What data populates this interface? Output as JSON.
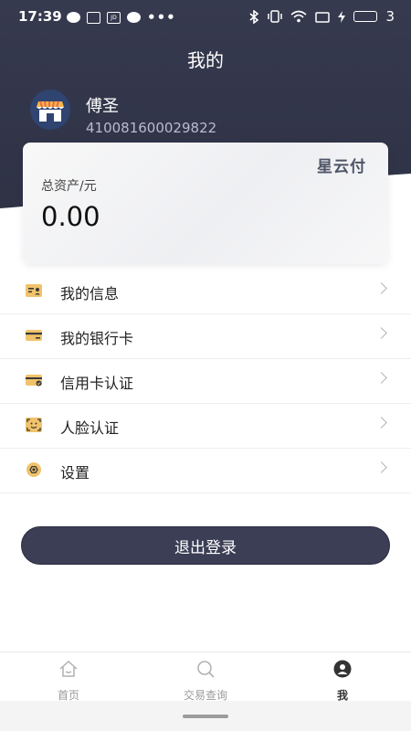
{
  "status_bar": {
    "time": "17:39",
    "notif_app_label": "JD",
    "battery_level": "3",
    "icons": [
      "chat-icon",
      "news-icon",
      "jd-icon",
      "chat-icon",
      "more-icon",
      "bluetooth-icon",
      "vibrate-icon",
      "wifi-icon",
      "battery-icon"
    ]
  },
  "header": {
    "title": "我的",
    "user_name": "傅圣",
    "user_id": "410081600029822"
  },
  "asset_card": {
    "brand": "星云付",
    "label": "总资产/元",
    "value": "0.00"
  },
  "menu": [
    {
      "label": "我的信息",
      "icon": "id-card-icon"
    },
    {
      "label": "我的银行卡",
      "icon": "bank-card-icon"
    },
    {
      "label": "信用卡认证",
      "icon": "credit-card-verify-icon"
    },
    {
      "label": "人脸认证",
      "icon": "face-scan-icon"
    },
    {
      "label": "设置",
      "icon": "settings-icon"
    }
  ],
  "logout_label": "退出登录",
  "bottom_nav": [
    {
      "label": "首页",
      "icon": "home-icon",
      "active": false
    },
    {
      "label": "交易查询",
      "icon": "search-icon",
      "active": false
    },
    {
      "label": "我",
      "icon": "profile-icon",
      "active": true
    }
  ],
  "colors": {
    "header": "#363a4f",
    "accent_icon": "#f0c36b",
    "button": "#3b3e55"
  }
}
